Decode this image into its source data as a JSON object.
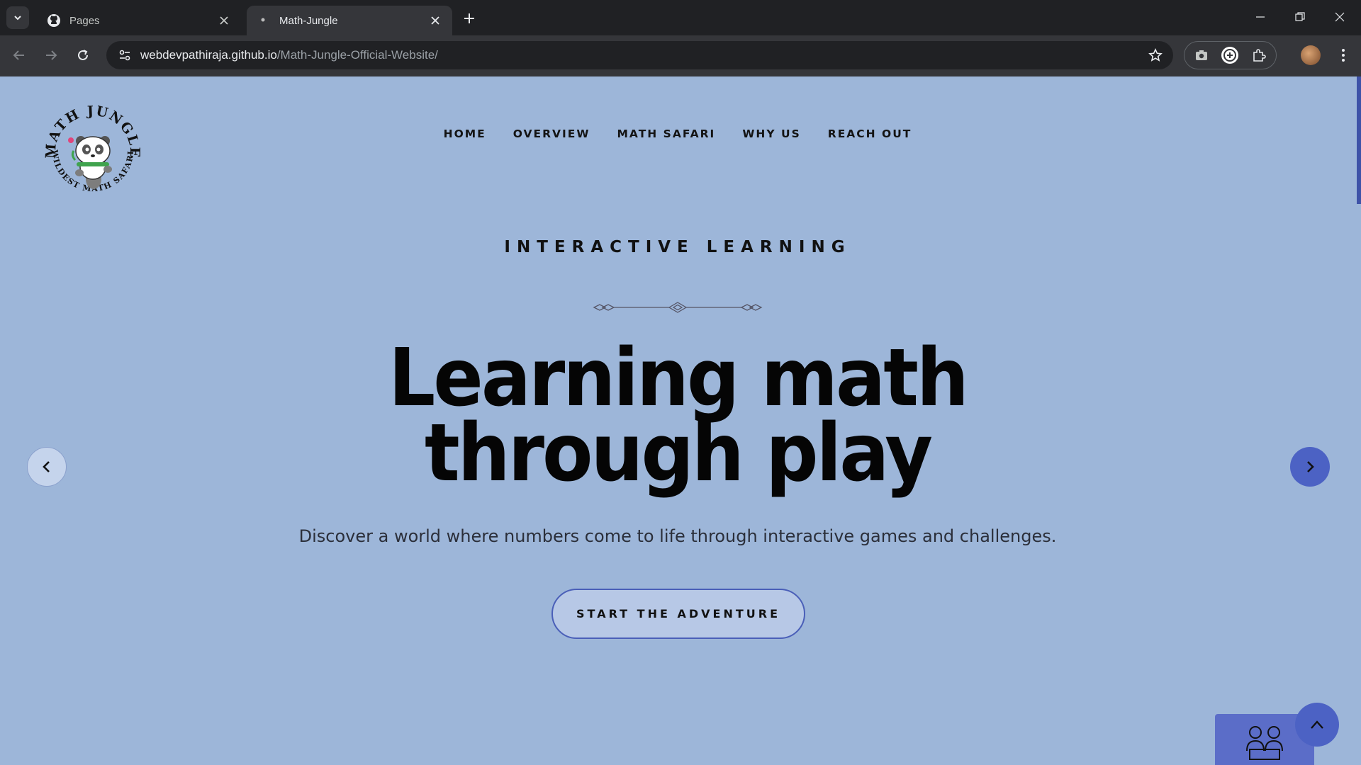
{
  "browser": {
    "tabs": [
      {
        "title": "Pages",
        "favicon": "github-icon",
        "active": false
      },
      {
        "title": "Math-Jungle",
        "favicon": "site-favicon",
        "active": true
      }
    ],
    "url": {
      "host": "webdevpathiraja.github.io",
      "path": "/Math-Jungle-Official-Website/"
    },
    "extensions": [
      "screenshot-icon",
      "translate-icon",
      "puzzle-icon"
    ]
  },
  "site": {
    "logo": {
      "top_text": "MATH JUNGLE",
      "bottom_text": "WILDEST MATH SAFARI"
    },
    "nav": [
      "HOME",
      "OVERVIEW",
      "MATH SAFARI",
      "WHY US",
      "REACH OUT"
    ],
    "hero": {
      "eyebrow": "INTERACTIVE LEARNING",
      "headline_line1": "Learning math",
      "headline_line2": "through play",
      "subtitle": "Discover a world where numbers come to life through interactive games and challenges.",
      "cta": "START THE ADVENTURE"
    }
  },
  "colors": {
    "page_bg": "#9db6d9",
    "accent": "#4c62c4",
    "chrome_bg": "#202124",
    "chrome_toolbar": "#35363a"
  }
}
